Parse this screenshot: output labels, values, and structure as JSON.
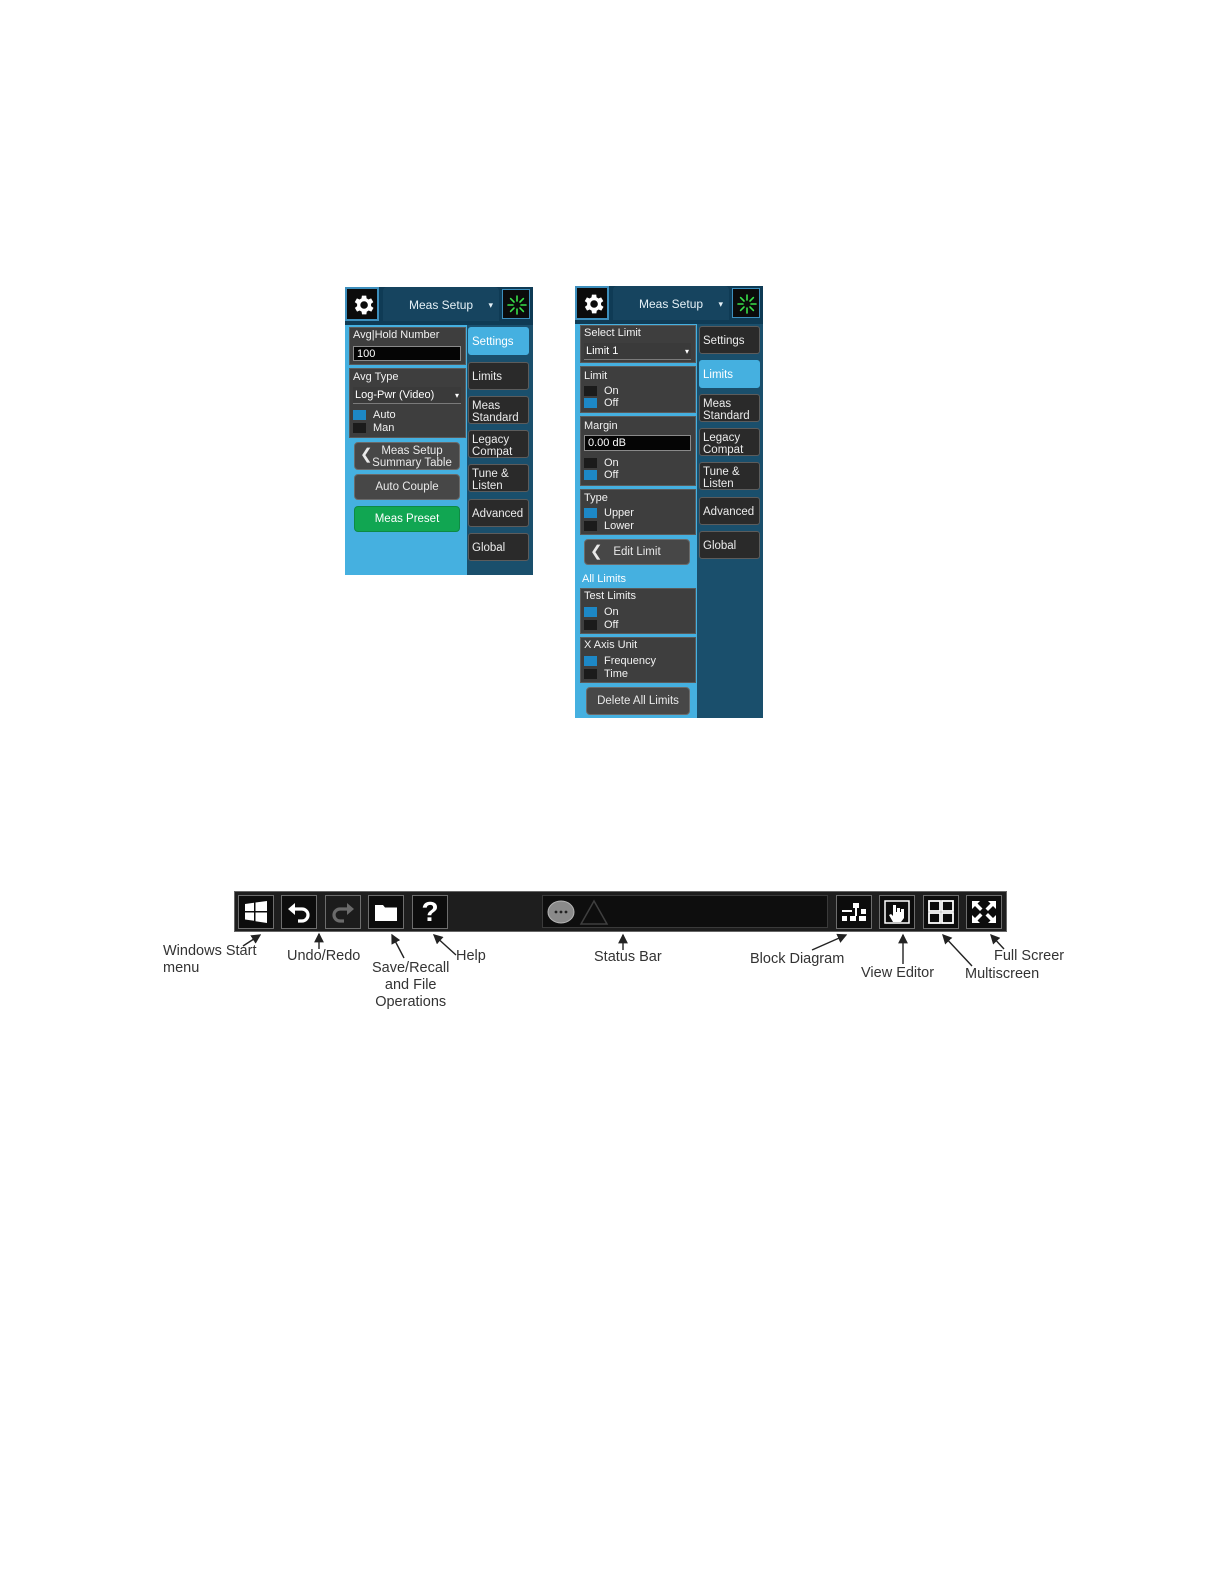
{
  "panel_left": {
    "header_title": "Meas Setup",
    "header_arrow": "▾",
    "avg_hold": {
      "label": "Avg|Hold Number",
      "value": "100"
    },
    "avg_type": {
      "label": "Avg Type",
      "value": "Log-Pwr (Video)",
      "arrow": "▾",
      "options": [
        "Auto",
        "Man"
      ],
      "selected": "Auto"
    },
    "summary_button": {
      "line1": "Meas Setup",
      "line2": "Summary Table",
      "chevron": "❮"
    },
    "auto_couple": "Auto Couple",
    "meas_preset": "Meas Preset",
    "tabs": [
      {
        "line1": "Settings",
        "line2": ""
      },
      {
        "line1": "Limits",
        "line2": ""
      },
      {
        "line1": "Meas",
        "line2": "Standard"
      },
      {
        "line1": "Legacy",
        "line2": "Compat"
      },
      {
        "line1": "Tune &",
        "line2": "Listen"
      },
      {
        "line1": "Advanced",
        "line2": ""
      },
      {
        "line1": "Global",
        "line2": ""
      }
    ],
    "active_tab": "Settings"
  },
  "panel_right": {
    "header_title": "Meas Setup",
    "header_arrow": "▾",
    "select_limit": {
      "label": "Select Limit",
      "value": "Limit 1",
      "arrow": "▾"
    },
    "limit": {
      "label": "Limit",
      "options": [
        "On",
        "Off"
      ],
      "selected": "Off"
    },
    "margin": {
      "label": "Margin",
      "value": "0.00 dB",
      "options": [
        "On",
        "Off"
      ],
      "selected": "Off"
    },
    "type": {
      "label": "Type",
      "options": [
        "Upper",
        "Lower"
      ],
      "selected": "Upper"
    },
    "edit_limit": {
      "label": "Edit Limit",
      "chevron": "❮"
    },
    "all_limits": "All Limits",
    "test_limits": {
      "label": "Test Limits",
      "options": [
        "On",
        "Off"
      ],
      "selected": "On"
    },
    "x_axis_unit": {
      "label": "X Axis Unit",
      "options": [
        "Frequency",
        "Time"
      ],
      "selected": "Frequency"
    },
    "delete_all": "Delete All Limits",
    "tabs": [
      {
        "line1": "Settings",
        "line2": ""
      },
      {
        "line1": "Limits",
        "line2": ""
      },
      {
        "line1": "Meas",
        "line2": "Standard"
      },
      {
        "line1": "Legacy",
        "line2": "Compat"
      },
      {
        "line1": "Tune &",
        "line2": "Listen"
      },
      {
        "line1": "Advanced",
        "line2": ""
      },
      {
        "line1": "Global",
        "line2": ""
      }
    ],
    "active_tab": "Limits"
  },
  "taskbar": {
    "icons": [
      "windows-start-icon",
      "undo-icon",
      "redo-icon",
      "folder-icon",
      "help-icon",
      "message-icon",
      "warning-icon",
      "block-diagram-icon",
      "view-editor-icon",
      "multiscreen-icon",
      "full-screen-icon"
    ],
    "help_glyph": "?"
  },
  "callouts": {
    "windows_start_1": "Windows Start",
    "windows_start_2": "menu",
    "undo_redo": "Undo/Redo",
    "save_recall_1": "Save/Recall",
    "save_recall_2": "and File",
    "save_recall_3": "Operations",
    "help": "Help",
    "status_bar": "Status Bar",
    "block_diagram": "Block Diagram",
    "view_editor": "View Editor",
    "multiscreen": "Multiscreen",
    "full_screen": "Full Screer"
  }
}
